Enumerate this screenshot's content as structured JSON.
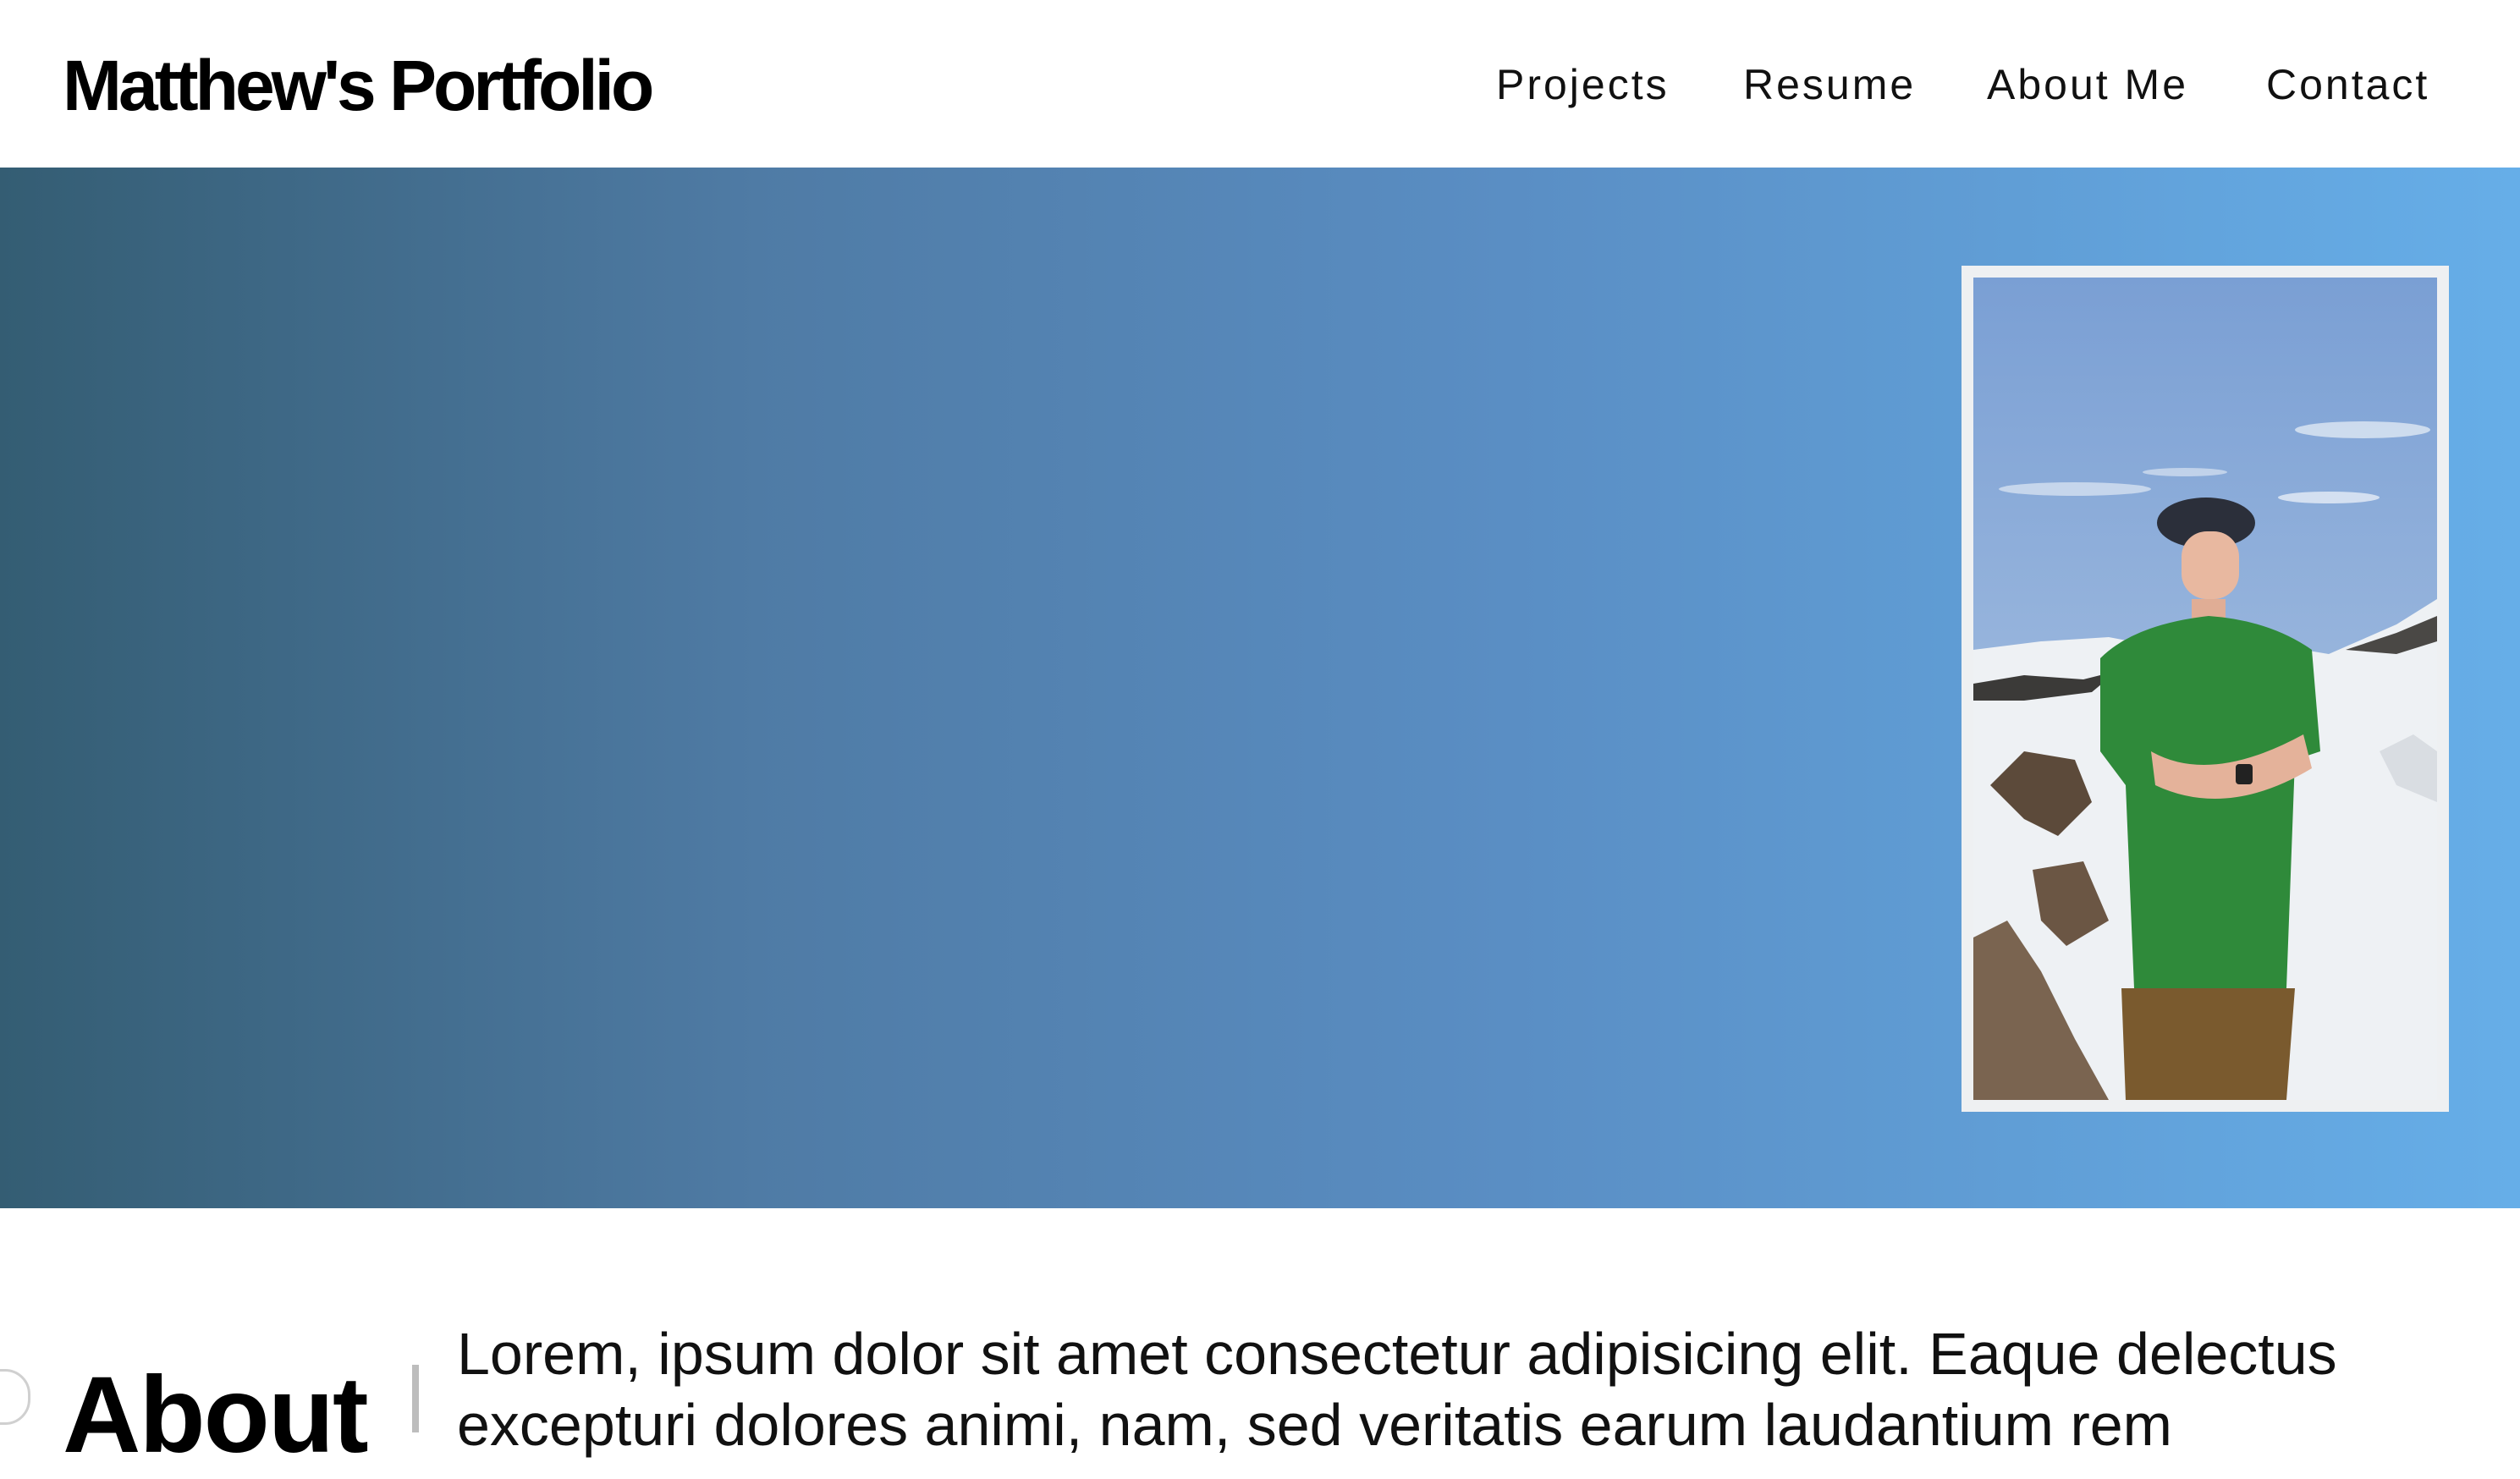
{
  "header": {
    "site_title": "Matthew's Portfolio",
    "nav": [
      {
        "label": "Projects"
      },
      {
        "label": "Resume"
      },
      {
        "label": "About Me"
      },
      {
        "label": "Contact"
      }
    ]
  },
  "hero": {
    "gradient_colors": [
      "#345d73",
      "#66aee8"
    ],
    "photo_frame_color": "#eef0f2",
    "photo_subject": "person in green t-shirt and cap on snowy mountain"
  },
  "about": {
    "heading": "About",
    "paragraph": "Lorem, ipsum dolor sit amet consectetur adipisicing elit. Eaque delectus excepturi dolores animi, nam, sed veritatis earum laudantium rem"
  }
}
